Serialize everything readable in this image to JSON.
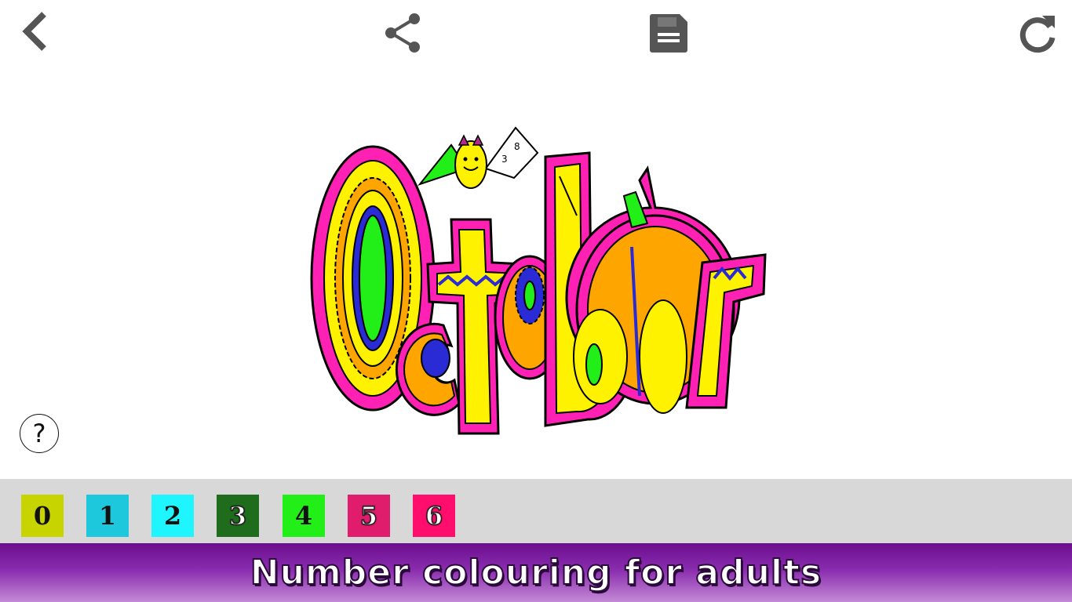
{
  "toolbar": {
    "back_icon": "chevron-left-icon",
    "share_icon": "share-icon",
    "save_icon": "floppy-disk-icon",
    "reset_icon": "refresh-icon",
    "icon_color": "#555555"
  },
  "artwork": {
    "word": "October",
    "bat_wing_numbers": [
      "3",
      "8"
    ]
  },
  "help": {
    "label": "?"
  },
  "palette": [
    {
      "number": "0",
      "color": "#c8d400"
    },
    {
      "number": "1",
      "color": "#1ec8dc"
    },
    {
      "number": "2",
      "color": "#1ef5ff"
    },
    {
      "number": "3",
      "color": "#1f6d1c"
    },
    {
      "number": "4",
      "color": "#22ee18"
    },
    {
      "number": "5",
      "color": "#e01c6c"
    },
    {
      "number": "6",
      "color": "#ff0e6e"
    }
  ],
  "banner": {
    "text": "Number colouring for adults"
  }
}
